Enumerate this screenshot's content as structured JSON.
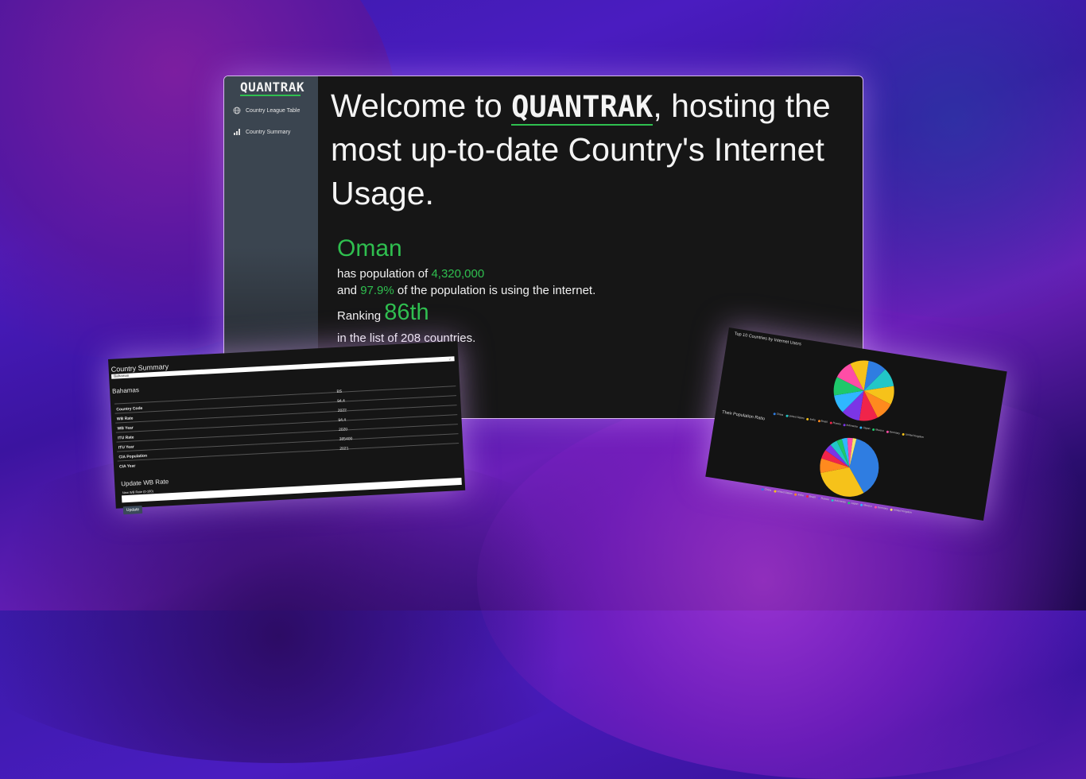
{
  "brand": "QUANTRAK",
  "nav": [
    {
      "label": "Country League Table",
      "icon": "globe-icon"
    },
    {
      "label": "Country Summary",
      "icon": "bar-chart-icon"
    }
  ],
  "welcome": {
    "prefix": "Welcome to ",
    "brand": "QUANTRAK",
    "suffix": ", hosting the most up-to-date Country's Internet Usage."
  },
  "stats": {
    "country": "Oman",
    "pop_prefix": "has population of ",
    "population": "4,320,000",
    "and": "and ",
    "rate": "97.9%",
    "rate_suffix": " of the population is using the internet.",
    "ranking_label": "Ranking ",
    "rank": "86th",
    "list_text": "in the list of 208 countries."
  },
  "summary": {
    "title": "Country Summary",
    "selected": "Bahamas",
    "country_name": "Bahamas",
    "rows": [
      {
        "key": "Country Code",
        "value": "BS"
      },
      {
        "key": "WB Rate",
        "value": "94.4"
      },
      {
        "key": "WB Year",
        "value": "2022"
      },
      {
        "key": "ITU Rate",
        "value": "94.4"
      },
      {
        "key": "ITU Year",
        "value": "2020"
      },
      {
        "key": "CIA Population",
        "value": "385400"
      },
      {
        "key": "CIA Year",
        "value": "2021"
      }
    ],
    "update_title": "Update WB Rate",
    "input_label": "New WB Rate (0-100)",
    "button": "Update"
  },
  "colors": {
    "accent": "#2fbf4f",
    "sidebar": "#3b4550",
    "panel": "#161616"
  },
  "chart_data": [
    {
      "type": "pie",
      "title": "Top 10 Countries by Internet Users",
      "categories": [
        "China",
        "United States",
        "India",
        "Brazil",
        "Russia",
        "Indonesia",
        "Japan",
        "Mexico",
        "Germany",
        "United Kingdom"
      ],
      "values": [
        10,
        10,
        10,
        10,
        10,
        10,
        10,
        10,
        10,
        10
      ],
      "colors": [
        "#2f7de1",
        "#22c7c7",
        "#f6c21a",
        "#ff8a1e",
        "#f0244a",
        "#7b35e6",
        "#2fb7ff",
        "#1ec86b",
        "#ff4da6",
        "#f6c21a"
      ]
    },
    {
      "type": "pie",
      "title": "Their Population Ratio",
      "categories": [
        "China",
        "United States",
        "India",
        "Brazil",
        "Russia",
        "Indonesia",
        "Japan",
        "Mexico",
        "Germany",
        "United Kingdom"
      ],
      "values": [
        38,
        30,
        8,
        5,
        4,
        4,
        3,
        3,
        3,
        2
      ],
      "colors": [
        "#2f7de1",
        "#f6c21a",
        "#ff8a1e",
        "#f0244a",
        "#7b35e6",
        "#22c7c7",
        "#1ec86b",
        "#2fb7ff",
        "#ff4da6",
        "#f6e76a"
      ]
    }
  ]
}
